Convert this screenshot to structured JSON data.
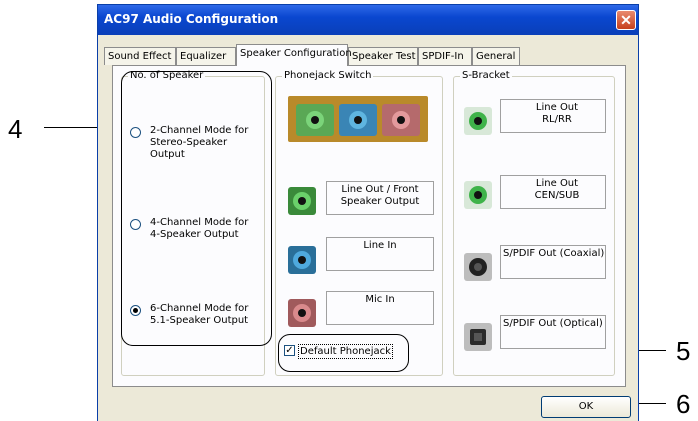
{
  "window": {
    "title": "AC97 Audio Configuration",
    "close_glyph": "✕"
  },
  "tabs": [
    "Sound Effect",
    "Equalizer",
    "Speaker Configuration",
    "Speaker Test",
    "SPDIF-In",
    "General"
  ],
  "active_tab": "Speaker Configuration",
  "no_of_speaker": {
    "label": "No. of Speaker",
    "options": [
      {
        "text": "2-Channel Mode for Stereo-Speaker Output",
        "checked": false
      },
      {
        "text": "4-Channel Mode for 4-Speaker Output",
        "checked": false
      },
      {
        "text": "6-Channel Mode for 5.1-Speaker Output",
        "checked": true
      }
    ]
  },
  "phonejack_switch": {
    "label": "Phonejack Switch",
    "jacks": [
      {
        "label": "Line Out / Front Speaker Output",
        "color": "#3fb34a"
      },
      {
        "label": "Line In",
        "color": "#2a8fc7"
      },
      {
        "label": "Mic In",
        "color": "#d77e80"
      }
    ],
    "default_checkbox": {
      "label": "Default Phonejack",
      "checked": true,
      "check_glyph": "✓"
    }
  },
  "s_bracket": {
    "label": "S-Bracket",
    "jacks": [
      {
        "label": "Line Out RL/RR",
        "color": "#3fb34a"
      },
      {
        "label": "Line Out CEN/SUB",
        "color": "#3fb34a"
      },
      {
        "label": "S/PDIF Out (Coaxial)",
        "color": "#222222"
      },
      {
        "label": "S/PDIF Out (Optical)",
        "color": "#333333"
      }
    ]
  },
  "ok_button": "OK",
  "callouts": [
    "4",
    "5",
    "6"
  ]
}
